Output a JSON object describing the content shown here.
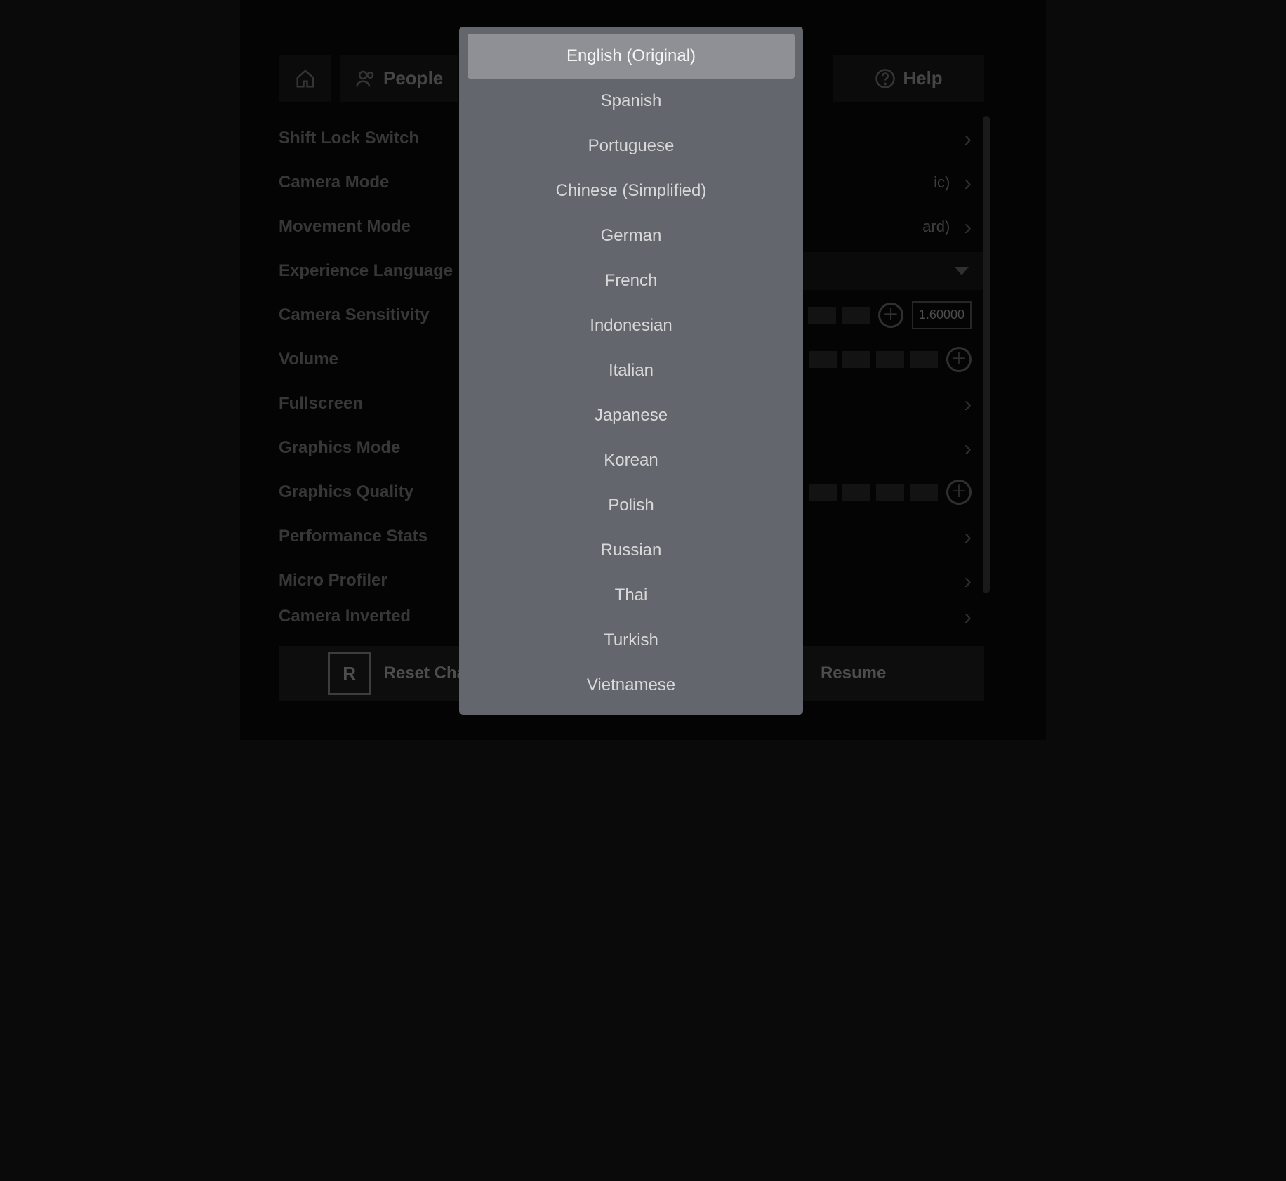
{
  "tabs": {
    "people": "People",
    "help": "Help"
  },
  "settings": {
    "shift_lock": "Shift Lock Switch",
    "camera_mode": {
      "label": "Camera Mode",
      "value_suffix": "ic)"
    },
    "movement_mode": {
      "label": "Movement Mode",
      "value_suffix": "ard)"
    },
    "experience_language": "Experience Language",
    "camera_sensitivity": {
      "label": "Camera Sensitivity",
      "value": "1.60000"
    },
    "volume": "Volume",
    "fullscreen": "Fullscreen",
    "graphics_mode": "Graphics Mode",
    "graphics_quality": "Graphics Quality",
    "performance_stats": "Performance Stats",
    "micro_profiler": "Micro Profiler",
    "camera_inverted": "Camera Inverted"
  },
  "footer": {
    "reset_key": "R",
    "reset_label": "Reset Charac",
    "resume_label": "Resume"
  },
  "language_modal": {
    "selected_index": 0,
    "options": [
      "English (Original)",
      "Spanish",
      "Portuguese",
      "Chinese (Simplified)",
      "German",
      "French",
      "Indonesian",
      "Italian",
      "Japanese",
      "Korean",
      "Polish",
      "Russian",
      "Thai",
      "Turkish",
      "Vietnamese"
    ]
  }
}
